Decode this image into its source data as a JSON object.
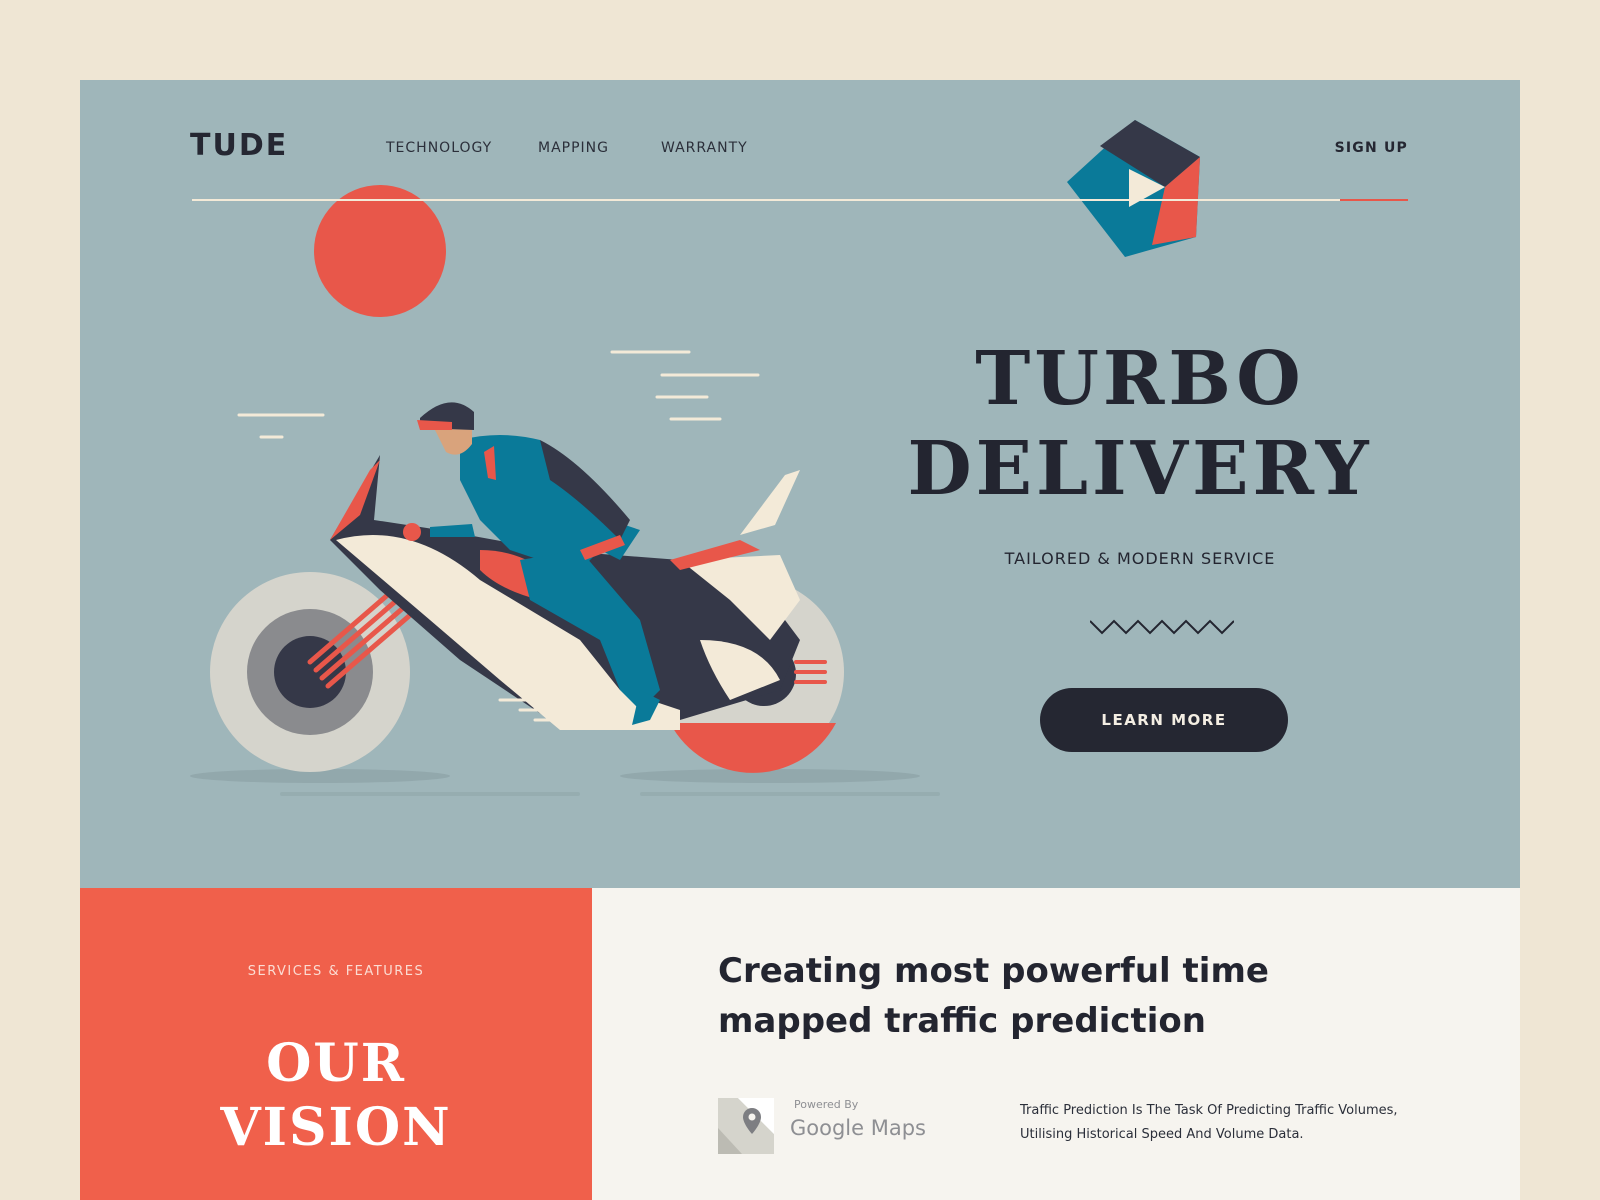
{
  "brand": {
    "logo": "TUDE"
  },
  "nav": {
    "items": [
      {
        "label": "TECHNOLOGY"
      },
      {
        "label": "MAPPING"
      },
      {
        "label": "WARRANTY"
      }
    ],
    "signup": "SIGN UP"
  },
  "hero": {
    "title_line1": "TURBO",
    "title_line2": "DELIVERY",
    "subtitle": "TAILORED & MODERN SERVICE",
    "cta": "LEARN MORE"
  },
  "vision": {
    "eyebrow": "SERVICES & FEATURES",
    "title_line1": "OUR",
    "title_line2": "VISION"
  },
  "info": {
    "heading": "Creating most powerful time mapped traffic prediction",
    "powered_by": "Powered By",
    "maps_name": "Google Maps",
    "description": "Traffic Prediction Is The Task Of Predicting Traffic Volumes, Utilising Historical Speed And Volume Data."
  },
  "colors": {
    "background": "#efe6d4",
    "hero": "#9fb6ba",
    "accent": "#e8574a",
    "vision": "#f0604b",
    "dark": "#252732",
    "teal": "#0a7a99",
    "cream": "#f3ead8"
  },
  "icons": [
    "pentagon-logo-icon",
    "map-pin-icon",
    "zigzag-icon"
  ]
}
